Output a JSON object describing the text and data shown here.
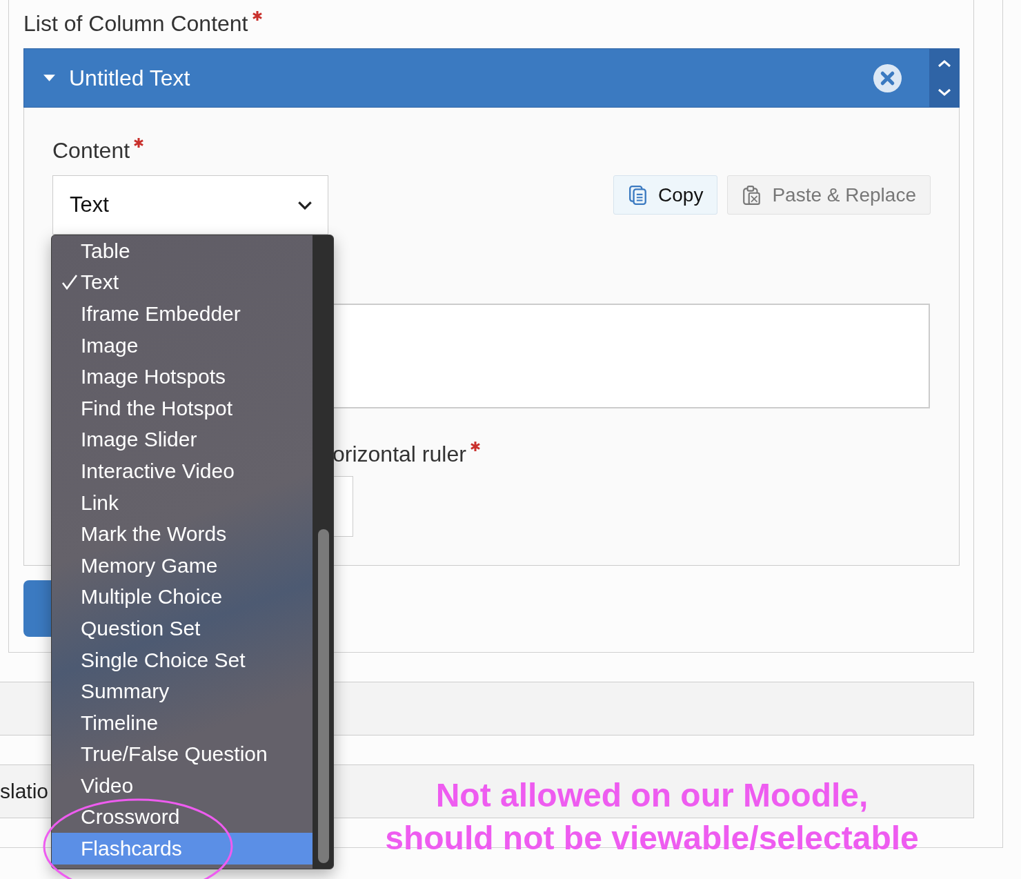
{
  "form": {
    "title": "List of Column Content",
    "required": true
  },
  "group": {
    "title": "Untitled Text",
    "expanded": true,
    "content_label": "Content",
    "content_required": true,
    "select_value": "Text",
    "copy_button": "Copy",
    "paste_button": {
      "label": "Paste & Replace",
      "disabled": true
    },
    "ruler_label": "orizontal ruler",
    "ruler_required": true
  },
  "translation_panel": {
    "label": "slatio"
  },
  "dropdown": {
    "items": [
      {
        "label": "Table",
        "checked": false,
        "selected": false
      },
      {
        "label": "Text",
        "checked": true,
        "selected": false
      },
      {
        "label": "Iframe Embedder",
        "checked": false,
        "selected": false
      },
      {
        "label": "Image",
        "checked": false,
        "selected": false
      },
      {
        "label": "Image Hotspots",
        "checked": false,
        "selected": false
      },
      {
        "label": "Find the Hotspot",
        "checked": false,
        "selected": false
      },
      {
        "label": "Image Slider",
        "checked": false,
        "selected": false
      },
      {
        "label": "Interactive Video",
        "checked": false,
        "selected": false
      },
      {
        "label": "Link",
        "checked": false,
        "selected": false
      },
      {
        "label": "Mark the Words",
        "checked": false,
        "selected": false
      },
      {
        "label": "Memory Game",
        "checked": false,
        "selected": false
      },
      {
        "label": "Multiple Choice",
        "checked": false,
        "selected": false
      },
      {
        "label": "Question Set",
        "checked": false,
        "selected": false
      },
      {
        "label": "Single Choice Set",
        "checked": false,
        "selected": false
      },
      {
        "label": "Summary",
        "checked": false,
        "selected": false
      },
      {
        "label": "Timeline",
        "checked": false,
        "selected": false
      },
      {
        "label": "True/False Question",
        "checked": false,
        "selected": false
      },
      {
        "label": "Video",
        "checked": false,
        "selected": false
      },
      {
        "label": "Crossword",
        "checked": false,
        "selected": false
      },
      {
        "label": "Flashcards",
        "checked": false,
        "selected": true
      }
    ]
  },
  "annotation": {
    "lines": [
      "Not allowed on our Moodle,",
      "should not be viewable/selectable"
    ]
  }
}
